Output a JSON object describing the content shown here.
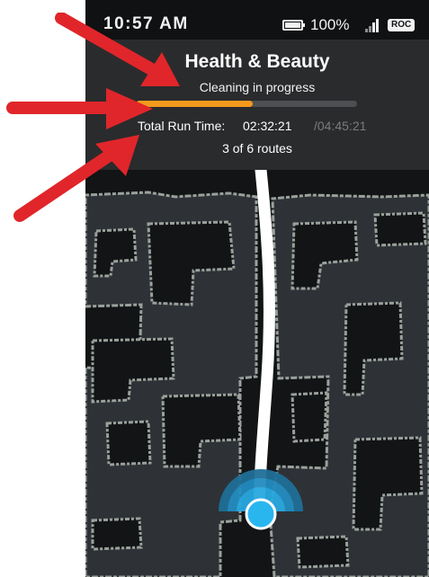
{
  "status_bar": {
    "time": "10:57 AM",
    "battery_percent": "100%",
    "network_badge": "ROC",
    "battery_icon": "battery-full-icon",
    "signal_icon": "cell-signal-icon"
  },
  "header": {
    "title": "Health & Beauty",
    "subtitle": "Cleaning in progress",
    "progress_fraction": 0.53,
    "run_time_label": "Total Run Time:",
    "run_time_elapsed": "02:32:21",
    "run_time_total": "/04:45:21",
    "routes_text": "3 of 6 routes"
  },
  "map": {
    "robot_icon": "robot-location-icon",
    "path_color": "#ffffff",
    "scan_color": "#29a9e0"
  },
  "annotations": {
    "arrow_color": "#e0262a",
    "arrow_icon": "red-arrow-icon"
  },
  "colors": {
    "accent": "#f39a1c",
    "header_bg": "#2a2b2d",
    "map_bg": "#121416",
    "wall": "#9aa19b",
    "floor": "#2e3236"
  }
}
